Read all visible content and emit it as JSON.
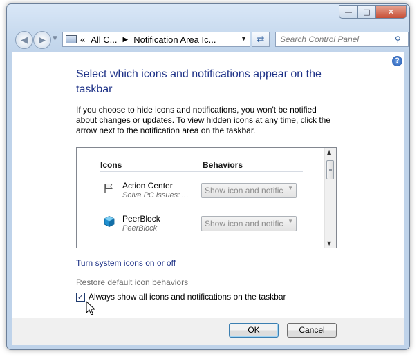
{
  "window": {
    "caption_buttons": {
      "minimize": "minimize-icon",
      "maximize": "maximize-icon",
      "close": "close-icon"
    }
  },
  "navbar": {
    "address_segments": [
      "«",
      "All C...",
      "Notification Area Ic..."
    ],
    "search_placeholder": "Search Control Panel"
  },
  "content": {
    "heading": "Select which icons and notifications appear on the taskbar",
    "description": "If you choose to hide icons and notifications, you won't be notified about changes or updates. To view hidden icons at any time, click the arrow next to the notification area on the taskbar.",
    "table": {
      "col_icons": "Icons",
      "col_behaviors": "Behaviors",
      "rows": [
        {
          "title": "Action Center",
          "subtitle": "Solve PC issues: ...",
          "behavior": "Show icon and notific",
          "icon": "flag-icon"
        },
        {
          "title": "PeerBlock",
          "subtitle": "PeerBlock",
          "behavior": "Show icon and notific",
          "icon": "cube-icon"
        }
      ]
    },
    "link_system_icons": "Turn system icons on or off",
    "link_restore": "Restore default icon behaviors",
    "checkbox_label": "Always show all icons and notifications on the taskbar",
    "checkbox_checked": true
  },
  "footer": {
    "ok": "OK",
    "cancel": "Cancel"
  }
}
